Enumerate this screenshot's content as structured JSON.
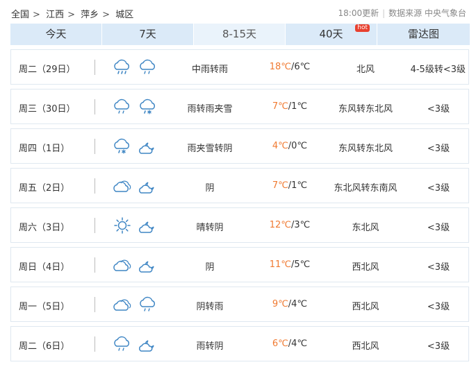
{
  "breadcrumb": {
    "items": [
      "全国",
      "江西",
      "萍乡",
      "城区"
    ],
    "separator": ">"
  },
  "source": {
    "update_time": "18:00更新",
    "label": "数据来源 中央气象台"
  },
  "tabs": [
    {
      "label": "今天",
      "active": false
    },
    {
      "label": "7天",
      "active": false
    },
    {
      "label": "8-15天",
      "active": true
    },
    {
      "label": "40天",
      "active": false,
      "badge": "hot"
    },
    {
      "label": "雷达图",
      "active": false
    }
  ],
  "colors": {
    "tab_bg": "#dbeaf8",
    "tab_active_bg": "#eaf3fb",
    "high_temp": "#f07a31",
    "icon_stroke": "#3f86c4",
    "hot_badge": "#e8412f"
  },
  "forecast": [
    {
      "day": "周二（29日）",
      "icon1": "rain-moderate-icon",
      "icon2": "rain-light-icon",
      "desc": "中雨转雨",
      "high": "18℃",
      "low": "/6℃",
      "wind": "北风",
      "level": "4-5级转<3级"
    },
    {
      "day": "周三（30日）",
      "icon1": "rain-light-icon",
      "icon2": "sleet-icon",
      "desc": "雨转雨夹雪",
      "high": "7℃",
      "low": "/1℃",
      "wind": "东风转东北风",
      "level": "<3级"
    },
    {
      "day": "周四（1日）",
      "icon1": "sleet-icon",
      "icon2": "overcast-night-icon",
      "desc": "雨夹雪转阴",
      "high": "4℃",
      "low": "/0℃",
      "wind": "东风转东北风",
      "level": "<3级"
    },
    {
      "day": "周五（2日）",
      "icon1": "overcast-icon",
      "icon2": "overcast-night-icon",
      "desc": "阴",
      "high": "7℃",
      "low": "/1℃",
      "wind": "东北风转东南风",
      "level": "<3级"
    },
    {
      "day": "周六（3日）",
      "icon1": "sunny-icon",
      "icon2": "overcast-night-icon",
      "desc": "晴转阴",
      "high": "12℃",
      "low": "/3℃",
      "wind": "东北风",
      "level": "<3级"
    },
    {
      "day": "周日（4日）",
      "icon1": "overcast-icon",
      "icon2": "overcast-night-icon",
      "desc": "阴",
      "high": "11℃",
      "low": "/5℃",
      "wind": "西北风",
      "level": "<3级"
    },
    {
      "day": "周一（5日）",
      "icon1": "overcast-icon",
      "icon2": "rain-light-icon",
      "desc": "阴转雨",
      "high": "9℃",
      "low": "/4℃",
      "wind": "西北风",
      "level": "<3级"
    },
    {
      "day": "周二（6日）",
      "icon1": "rain-light-icon",
      "icon2": "overcast-night-icon",
      "desc": "雨转阴",
      "high": "6℃",
      "low": "/4℃",
      "wind": "西北风",
      "level": "<3级"
    }
  ]
}
